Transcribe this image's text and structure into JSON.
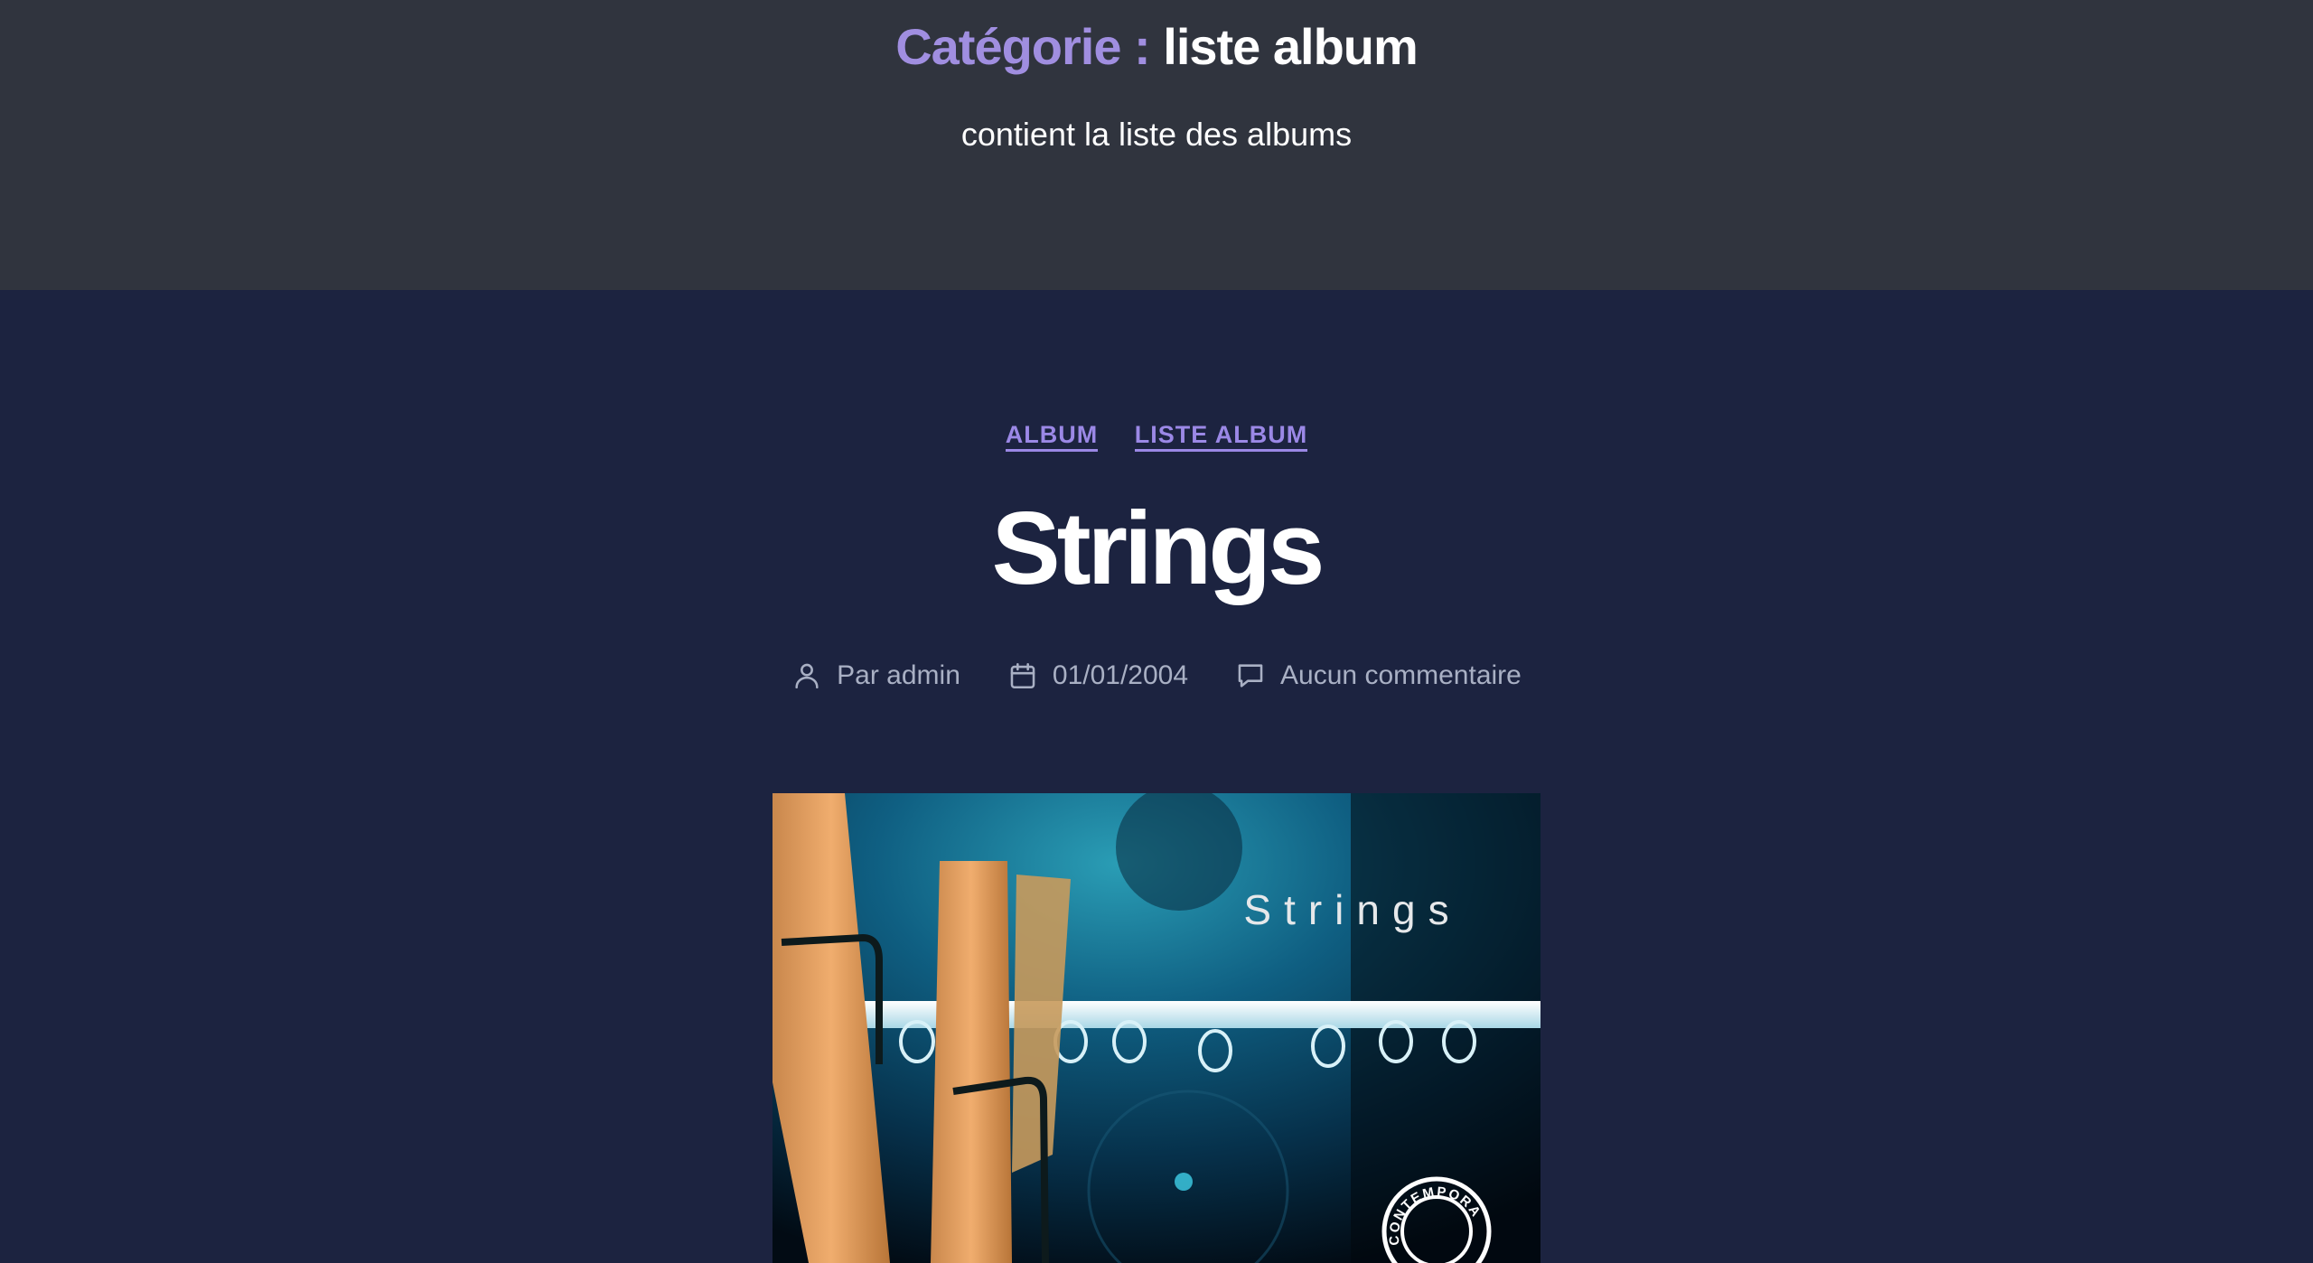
{
  "archive": {
    "prefix": "Catégorie :",
    "term": "liste album",
    "description": "contient la liste des albums"
  },
  "post": {
    "categories": [
      "ALBUM",
      "LISTE ALBUM"
    ],
    "title": "Strings",
    "meta": {
      "author": "Par admin",
      "date": "01/01/2004",
      "comments": "Aucun commentaire"
    },
    "cover": {
      "title": "Strings",
      "badge": "CONTEMPORARY"
    }
  },
  "icons": {
    "author": "user-icon",
    "date": "calendar-icon",
    "comments": "comment-bubble-icon"
  },
  "colors": {
    "header_bg": "#30343e",
    "page_bg": "#1c2340",
    "accent": "#9b88e6",
    "meta_text": "#a9b0c4"
  }
}
